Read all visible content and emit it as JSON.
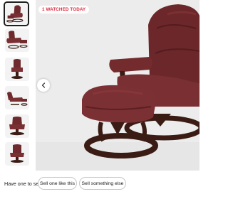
{
  "badge": {
    "text": "1 WATCHED TODAY",
    "color": "#e0243a"
  },
  "gallery": {
    "thumbnail_count": 6,
    "selected_index": 0,
    "prev_icon": "chevron-left-icon",
    "image_subject": "burgundy leather recliner chair with ottoman"
  },
  "colors": {
    "leather": "#6e2a2d",
    "wood_base": "#3a1c14",
    "background": "#ececec"
  },
  "footer": {
    "question": "Have one to sell?",
    "sell_like_label": "Sell one like this",
    "sell_else_label": "Sell something else"
  }
}
